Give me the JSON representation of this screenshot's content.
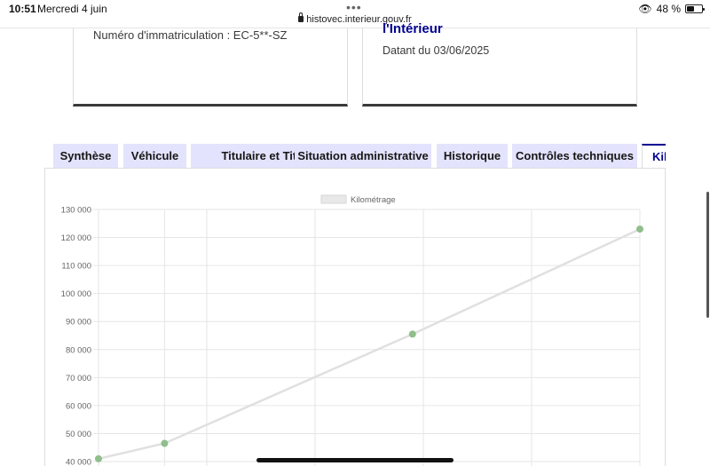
{
  "status_bar": {
    "time": "10:51",
    "date": "Mercredi 4 juin",
    "dots": "•••",
    "battery": "48 %",
    "eye_icon": "eye-icon",
    "battery_icon": "battery-icon"
  },
  "url_bar": {
    "url": "histovec.interieur.gouv.fr",
    "icon": "lock-icon"
  },
  "cards": {
    "left": {
      "plate_label": "Numéro d'immatriculation : EC-5**-SZ"
    },
    "right": {
      "agency": "l'Intérieur",
      "date_label": "Datant du 03/06/2025"
    }
  },
  "tabs": [
    {
      "label": "Synthèse",
      "active": false
    },
    {
      "label": "Véhicule",
      "active": false
    },
    {
      "label": "Titulaire et Titre",
      "active": false
    },
    {
      "label": "Situation administrative",
      "active": false
    },
    {
      "label": "Historique",
      "active": false
    },
    {
      "label": "Contrôles techniques",
      "active": false
    },
    {
      "label": "Kilométrage",
      "active": true
    }
  ],
  "colors": {
    "accent": "#000091",
    "tab_bg": "#e3e3fd",
    "line": "#e0e0e0",
    "point": "#8fbf8b"
  },
  "chart_data": {
    "type": "line",
    "title": "",
    "legend": [
      "Kilométrage"
    ],
    "legend_position": "top",
    "xlabel": "",
    "ylabel": "",
    "ylim": [
      40000,
      130000
    ],
    "y_ticks": [
      "130 000",
      "120 000",
      "110 000",
      "100 000",
      "90 000",
      "80 000",
      "70 000",
      "60 000",
      "50 000",
      "40 000"
    ],
    "grid": true,
    "series": [
      {
        "name": "Kilométrage",
        "points": [
          {
            "x": 0.0,
            "y": 41000
          },
          {
            "x": 0.61,
            "y": 46500
          },
          {
            "x": 2.9,
            "y": 85500
          },
          {
            "x": 5.0,
            "y": 123000
          }
        ]
      }
    ]
  }
}
